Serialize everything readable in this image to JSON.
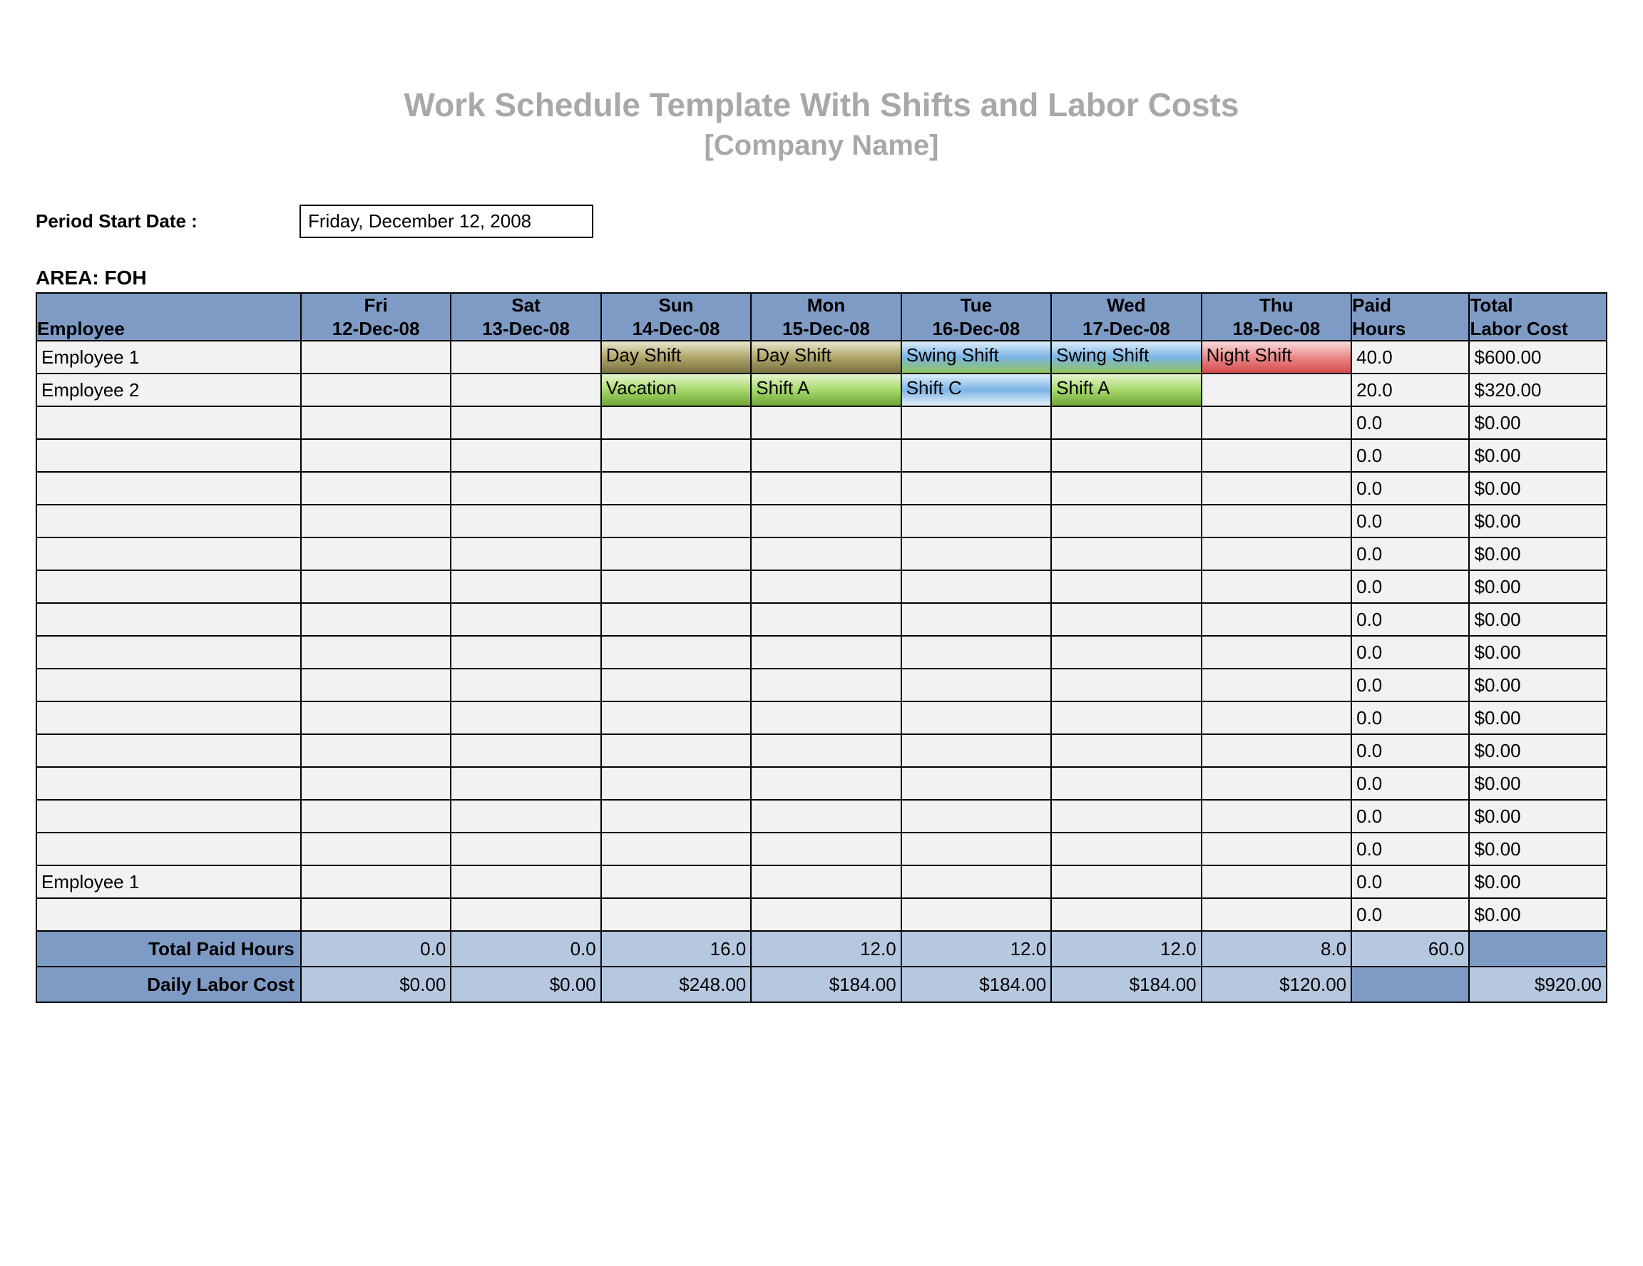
{
  "title": "Work Schedule Template With Shifts and Labor Costs",
  "subtitle": "[Company Name]",
  "period_label": "Period Start Date :",
  "period_value": "Friday, December 12, 2008",
  "area_label": "AREA: FOH",
  "shift_styles": {
    "Day Shift": "pill-olive",
    "Swing Shift": "pill-bluefull",
    "Night Shift": "pill-red",
    "Vacation": "pill-green",
    "Shift A": "pill-green",
    "Shift C": "pill-bluefaint"
  },
  "headers": {
    "employee": "Employee",
    "days": [
      {
        "dow": "Fri",
        "date": "12-Dec-08"
      },
      {
        "dow": "Sat",
        "date": "13-Dec-08"
      },
      {
        "dow": "Sun",
        "date": "14-Dec-08"
      },
      {
        "dow": "Mon",
        "date": "15-Dec-08"
      },
      {
        "dow": "Tue",
        "date": "16-Dec-08"
      },
      {
        "dow": "Wed",
        "date": "17-Dec-08"
      },
      {
        "dow": "Thu",
        "date": "18-Dec-08"
      }
    ],
    "paid_hours": "Paid Hours",
    "total_cost": "Total Labor Cost"
  },
  "rows": [
    {
      "name": "Employee 1",
      "shifts": [
        "",
        "",
        "Day Shift",
        "Day Shift",
        "Swing Shift",
        "Swing Shift",
        "Night Shift"
      ],
      "hours": "40.0",
      "cost": "$600.00"
    },
    {
      "name": "Employee 2",
      "shifts": [
        "",
        "",
        "Vacation",
        "Shift A",
        "Shift C",
        "Shift A",
        ""
      ],
      "hours": "20.0",
      "cost": "$320.00"
    },
    {
      "name": "",
      "shifts": [
        "",
        "",
        "",
        "",
        "",
        "",
        ""
      ],
      "hours": "0.0",
      "cost": "$0.00"
    },
    {
      "name": "",
      "shifts": [
        "",
        "",
        "",
        "",
        "",
        "",
        ""
      ],
      "hours": "0.0",
      "cost": "$0.00"
    },
    {
      "name": "",
      "shifts": [
        "",
        "",
        "",
        "",
        "",
        "",
        ""
      ],
      "hours": "0.0",
      "cost": "$0.00"
    },
    {
      "name": "",
      "shifts": [
        "",
        "",
        "",
        "",
        "",
        "",
        ""
      ],
      "hours": "0.0",
      "cost": "$0.00"
    },
    {
      "name": "",
      "shifts": [
        "",
        "",
        "",
        "",
        "",
        "",
        ""
      ],
      "hours": "0.0",
      "cost": "$0.00"
    },
    {
      "name": "",
      "shifts": [
        "",
        "",
        "",
        "",
        "",
        "",
        ""
      ],
      "hours": "0.0",
      "cost": "$0.00"
    },
    {
      "name": "",
      "shifts": [
        "",
        "",
        "",
        "",
        "",
        "",
        ""
      ],
      "hours": "0.0",
      "cost": "$0.00"
    },
    {
      "name": "",
      "shifts": [
        "",
        "",
        "",
        "",
        "",
        "",
        ""
      ],
      "hours": "0.0",
      "cost": "$0.00"
    },
    {
      "name": "",
      "shifts": [
        "",
        "",
        "",
        "",
        "",
        "",
        ""
      ],
      "hours": "0.0",
      "cost": "$0.00"
    },
    {
      "name": "",
      "shifts": [
        "",
        "",
        "",
        "",
        "",
        "",
        ""
      ],
      "hours": "0.0",
      "cost": "$0.00"
    },
    {
      "name": "",
      "shifts": [
        "",
        "",
        "",
        "",
        "",
        "",
        ""
      ],
      "hours": "0.0",
      "cost": "$0.00"
    },
    {
      "name": "",
      "shifts": [
        "",
        "",
        "",
        "",
        "",
        "",
        ""
      ],
      "hours": "0.0",
      "cost": "$0.00"
    },
    {
      "name": "",
      "shifts": [
        "",
        "",
        "",
        "",
        "",
        "",
        ""
      ],
      "hours": "0.0",
      "cost": "$0.00"
    },
    {
      "name": "",
      "shifts": [
        "",
        "",
        "",
        "",
        "",
        "",
        ""
      ],
      "hours": "0.0",
      "cost": "$0.00"
    },
    {
      "name": "Employee 1",
      "shifts": [
        "",
        "",
        "",
        "",
        "",
        "",
        ""
      ],
      "hours": "0.0",
      "cost": "$0.00"
    },
    {
      "name": "",
      "shifts": [
        "",
        "",
        "",
        "",
        "",
        "",
        ""
      ],
      "hours": "0.0",
      "cost": "$0.00"
    }
  ],
  "footer": {
    "total_paid_hours_label": "Total Paid Hours",
    "total_paid_hours": [
      "0.0",
      "0.0",
      "16.0",
      "12.0",
      "12.0",
      "12.0",
      "8.0"
    ],
    "total_paid_hours_sum": "60.0",
    "daily_labor_cost_label": "Daily Labor Cost",
    "daily_labor_cost": [
      "$0.00",
      "$0.00",
      "$248.00",
      "$184.00",
      "$184.00",
      "$184.00",
      "$120.00"
    ],
    "daily_labor_cost_sum": "$920.00"
  }
}
